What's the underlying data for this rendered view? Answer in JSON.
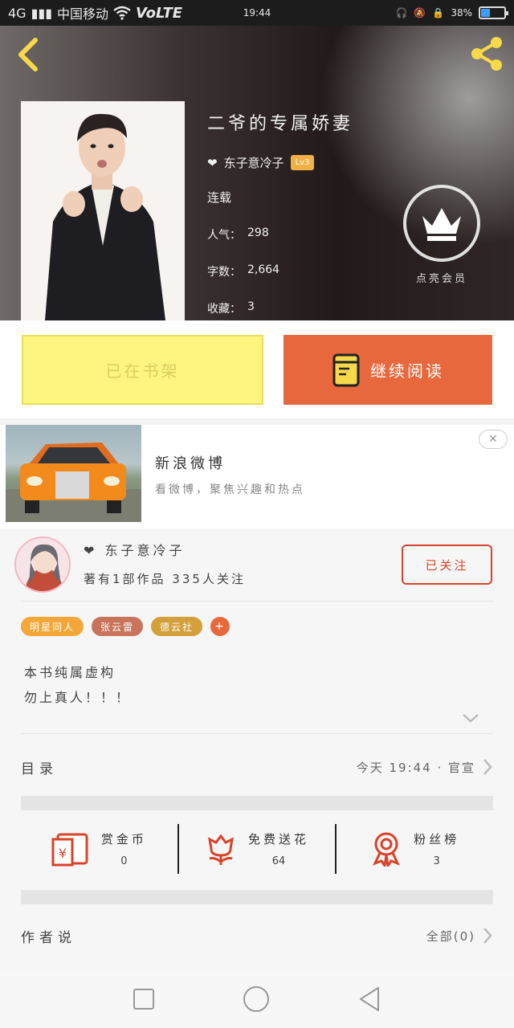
{
  "status_bar": {
    "network": "4G",
    "carrier": "中国移动",
    "volte": "VoLTE",
    "time": "19:44",
    "battery_text": "38%",
    "battery_level": 0.38
  },
  "book": {
    "title": "二爷的专属娇妻",
    "author": "东子意冷子",
    "level": "Lv3",
    "status": "连载",
    "popularity_label": "人气：",
    "popularity": "298",
    "words_label": "字数：",
    "words": "2,664",
    "favorites_label": "收藏：",
    "favorites": "3",
    "vip_label": "点亮会员"
  },
  "actions": {
    "shelf_label": "已在书架",
    "read_label": "继续阅读"
  },
  "ad": {
    "title": "新浪微博",
    "desc": "看微博，聚焦兴趣和热点",
    "close": "✕"
  },
  "author_info": {
    "name": "东子意冷子",
    "meta": "著有1部作品 335人关注",
    "follow_label": "已关注"
  },
  "tags": [
    {
      "label": "明星同人",
      "color": "#f4a739"
    },
    {
      "label": "张云雷",
      "color": "#c9745a"
    },
    {
      "label": "德云社",
      "color": "#d4a03c"
    },
    {
      "label": "+",
      "color": "#e8683d"
    }
  ],
  "description": {
    "line1": "本书纯属虚构",
    "line2": "勿上真人！！！"
  },
  "catalog": {
    "label": "目录",
    "update": "今天 19:44 · 官宣"
  },
  "rewards": [
    {
      "name": "赏金币",
      "value": "0",
      "icon": "red-envelope-icon"
    },
    {
      "name": "免费送花",
      "value": "64",
      "icon": "flower-icon"
    },
    {
      "name": "粉丝榜",
      "value": "3",
      "icon": "medal-icon"
    }
  ],
  "comments": {
    "label": "作者说",
    "all": "全部(0)"
  },
  "colors": {
    "accent": "#e8683d",
    "shelf_bg": "#fdf57f",
    "follow": "#d9432b"
  }
}
